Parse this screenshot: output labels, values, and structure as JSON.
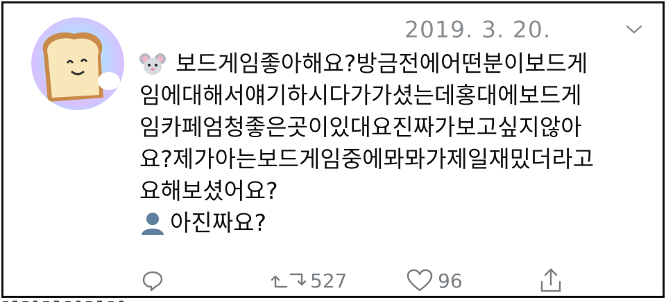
{
  "tweet": {
    "date": "2019. 3. 20.",
    "lines": [
      "보드게임좋아해요?방금전에어떤분이보드게",
      "임에대해서얘기하시다가가셨는데홍대에보드게",
      "임카페엄청좋은곳이있대요진짜가보고싶지않아",
      "요?제가아는보드게임중에뫄뫄가제일재밌더라고",
      "요해보셨어요?"
    ],
    "reply": "아진짜요?",
    "first_emoji": "mouse-face-emoji",
    "reply_emoji": "bust-silhouette-emoji"
  },
  "actions": {
    "retweets": "527",
    "likes": "96"
  },
  "colors": {
    "meta": "#8a8f93",
    "text": "#111111",
    "border": "#111111"
  }
}
